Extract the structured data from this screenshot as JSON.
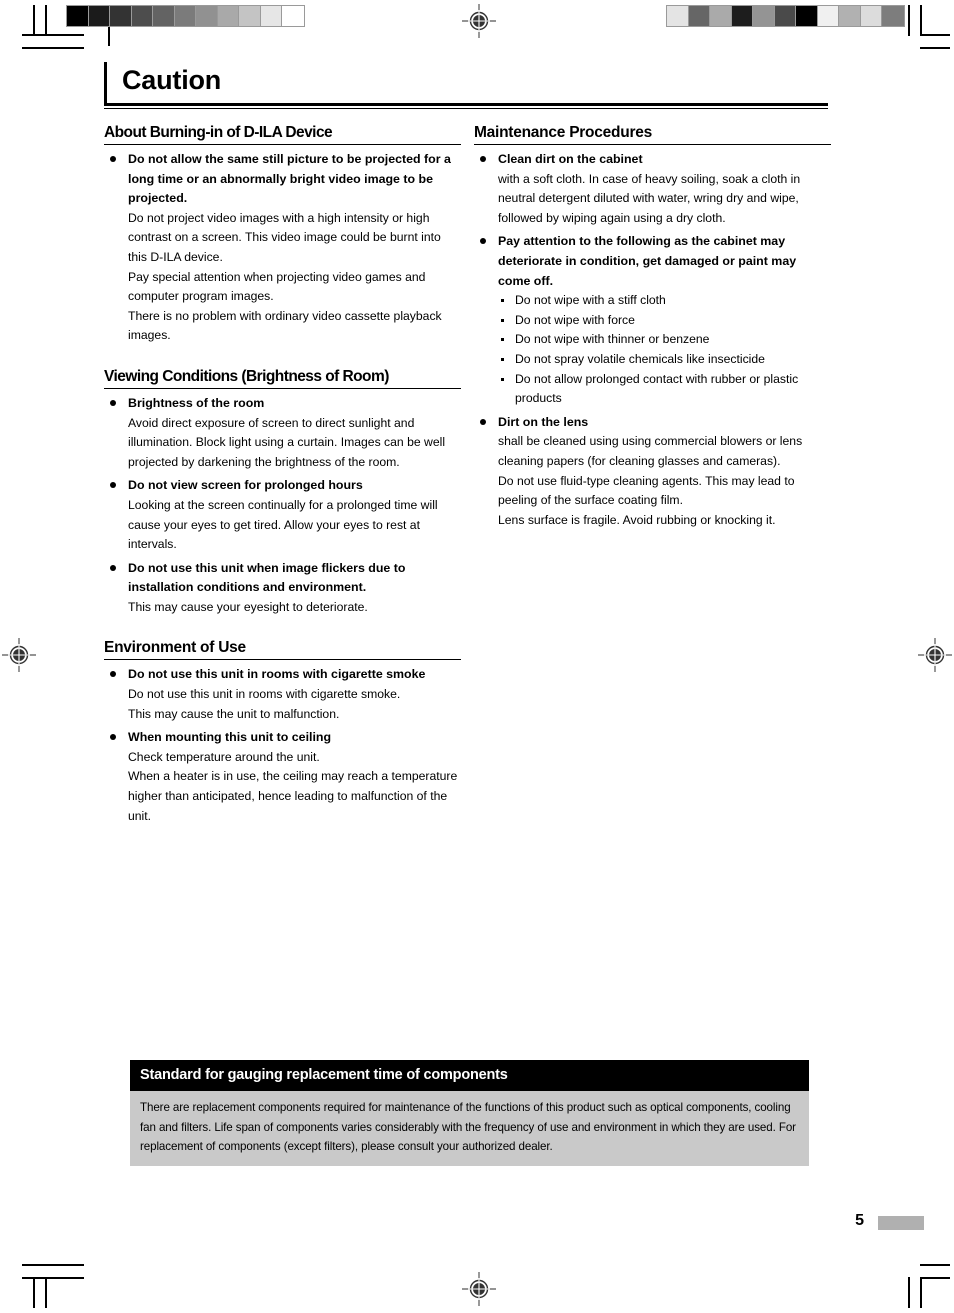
{
  "page": {
    "title": "Caution",
    "number": "5"
  },
  "marks": {
    "registration_icon": "registration-target-icon",
    "colorbar_left_name": "grayscale-step-wedge",
    "colorbar_right_name": "scrambled-gray-patches",
    "colorbar_left": [
      "#000000",
      "#1b1b1b",
      "#333333",
      "#4d4d4d",
      "#636363",
      "#7b7b7b",
      "#919191",
      "#a9a9a9",
      "#c4c4c4",
      "#e6e6e6",
      "#ffffff"
    ],
    "colorbar_right": [
      "#e4e4e4",
      "#666666",
      "#aaaaaa",
      "#1d1d1d",
      "#949494",
      "#4a4a4a",
      "#000000",
      "#f0f0f0",
      "#b1b1b1",
      "#dcdcdc",
      "#7d7d7d"
    ]
  },
  "columns": {
    "left": [
      {
        "heading": "About Burning-in of D-ILA Device",
        "bullets": [
          {
            "title": "Do not allow the same still picture to be projected for a long time or an abnormally bright video image to be projected.",
            "body": [
              "Do not project video images with a high intensity or high contrast on a screen. This video image could be burnt into this D-ILA device.",
              "Pay special attention when projecting video games and computer program images.",
              "There is no problem with ordinary video cassette playback images."
            ]
          }
        ]
      },
      {
        "heading": "Viewing Conditions (Brightness of Room)",
        "bullets": [
          {
            "title": "Brightness of the room",
            "body": [
              "Avoid direct exposure of screen to direct sunlight and illumination. Block light using a curtain. Images can be well projected by darkening the brightness of the room."
            ]
          },
          {
            "title": "Do not view screen for prolonged hours",
            "body": [
              "Looking at the screen continually for a prolonged time will cause your eyes to get tired. Allow your eyes to rest at intervals."
            ]
          },
          {
            "title": "Do not use this unit when image flickers due to installation conditions and environment.",
            "body": [
              "This may cause your eyesight to deteriorate."
            ]
          }
        ]
      },
      {
        "heading": "Environment of Use",
        "bullets": [
          {
            "title": "Do not use this unit in rooms with cigarette smoke",
            "body": [
              "Do not use this unit in rooms with cigarette smoke.",
              "This may cause the unit to malfunction."
            ]
          },
          {
            "title": "When mounting this unit to ceiling",
            "body": [
              "Check temperature around the unit.",
              "When a heater is in use, the ceiling may reach a temperature higher than anticipated, hence leading to malfunction of the unit."
            ]
          }
        ]
      }
    ],
    "right": [
      {
        "heading": "Maintenance Procedures",
        "bullets": [
          {
            "title": "Clean dirt on the cabinet",
            "body": [
              "with a soft cloth. In case of heavy soiling, soak a cloth in neutral detergent diluted with water, wring dry and wipe, followed by wiping again using a dry cloth."
            ]
          },
          {
            "title": "Pay attention to the following as the cabinet may deteriorate in condition, get damaged or paint may come off.",
            "body": [],
            "subbullets": [
              "Do not wipe with a stiff cloth",
              "Do not wipe with force",
              "Do not wipe with thinner or benzene",
              "Do not spray volatile chemicals like insecticide",
              "Do not allow prolonged contact with rubber or plastic products"
            ]
          },
          {
            "title": "Dirt on the lens",
            "body": [
              "shall be cleaned using using commercial blowers or lens cleaning papers (for cleaning glasses and cameras).",
              "Do not use fluid-type cleaning agents. This may lead to peeling of the surface coating film.",
              "Lens surface is fragile. Avoid rubbing or knocking it."
            ]
          }
        ]
      }
    ]
  },
  "notice": {
    "heading": "Standard for gauging replacement time of components",
    "body": "There are replacement components required for maintenance of the functions of this product such as optical components, cooling fan and filters. Life span of components varies considerably with the frequency of use and environment in which they are used. For replacement of components (except filters), please consult your authorized dealer."
  }
}
